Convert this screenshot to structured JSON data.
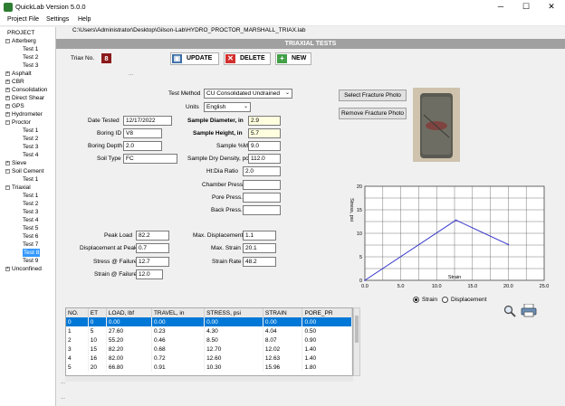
{
  "window": {
    "title": "QuickLab  Version 5.0.0",
    "minimize": "─",
    "maximize": "☐",
    "close": "✕"
  },
  "menu": {
    "items": [
      "Project File",
      "Settings",
      "Help"
    ]
  },
  "path": "C:\\Users\\Administrator\\Desktop\\Gilson-Lab\\HYDRO_PROCTOR_MARSHALL_TRIAX.lab",
  "tree": {
    "root": "PROJECT",
    "groups": [
      {
        "label": "Atterberg",
        "children": [
          "Test 1",
          "Test 2",
          "Test 3"
        ]
      },
      {
        "label": "Asphalt",
        "children": []
      },
      {
        "label": "CBR",
        "children": []
      },
      {
        "label": "Consolidation",
        "children": []
      },
      {
        "label": "Direct Shear",
        "children": []
      },
      {
        "label": "GPS",
        "children": []
      },
      {
        "label": "Hydrometer",
        "children": []
      },
      {
        "label": "Proctor",
        "children": [
          "Test 1",
          "Test 2",
          "Test 3",
          "Test 4"
        ]
      },
      {
        "label": "Sieve",
        "children": []
      },
      {
        "label": "Soil Cement",
        "children": [
          "Test 1"
        ]
      },
      {
        "label": "Triaxial",
        "children": [
          "Test 1",
          "Test 2",
          "Test 3",
          "Test 4",
          "Test 5",
          "Test 6",
          "Test 7",
          "Test 8",
          "Test 9"
        ]
      },
      {
        "label": "Unconfined",
        "children": []
      }
    ],
    "selected": "Triaxial/Test 8"
  },
  "header": {
    "title": "TRIAXIAL TESTS"
  },
  "triax": {
    "label": "Triax No.",
    "number": "8"
  },
  "actions": {
    "update": "UPDATE",
    "delete": "DELETE",
    "new": "NEW",
    "ellipsis": "..."
  },
  "form": {
    "test_method_label": "Test Method",
    "test_method": "CU Consolidated Undrained",
    "units_label": "Units",
    "units": "English",
    "date_tested_label": "Date Tested",
    "date_tested": "12/17/2022",
    "boring_id_label": "Boring ID",
    "boring_id": "V8",
    "boring_depth_label": "Boring Depth",
    "boring_depth": "2.0",
    "soil_type_label": "Soil Type",
    "soil_type": "FC",
    "sample_diameter_label": "Sample Diameter, in",
    "sample_diameter": "2.9",
    "sample_height_label": "Sample Height, in",
    "sample_height": "5.7",
    "sample_m_label": "Sample %M",
    "sample_m": "9.0",
    "sample_dry_density_label": "Sample Dry Density, pcf",
    "sample_dry_density": "112.0",
    "ht_dia_label": "Ht:Dia Ratio",
    "ht_dia": "2.0",
    "chamber_press_label": "Chamber Press.",
    "chamber_press": "",
    "pore_press_label": "Pore Press.",
    "pore_press": "",
    "back_press_label": "Back Press.",
    "back_press": "",
    "peak_load_label": "Peak Load",
    "peak_load": "82.2",
    "displacement_at_peak_label": "Displacement at Peak",
    "displacement_at_peak": "0.7",
    "stress_failure_label": "Stress @ Failure",
    "stress_failure": "12.7",
    "strain_failure_label": "Strain @ Failure",
    "strain_failure": "12.0",
    "max_displacement_label": "Max. Displacement",
    "max_displacement": "1.1",
    "max_strain_label": "Max. Strain",
    "max_strain": "20.1",
    "strain_rate_label": "Strain Rate",
    "strain_rate": "48.2"
  },
  "photo_buttons": {
    "select": "Select Fracture Photo",
    "remove": "Remove Fracture Photo"
  },
  "chart_data": {
    "type": "line",
    "xlabel": "Strain",
    "ylabel": "Stress, psi",
    "xlim": [
      0,
      25
    ],
    "ylim": [
      0,
      20
    ],
    "x_ticks": [
      "0.0",
      "5.0",
      "10.0",
      "15.0",
      "20.0",
      "25.0"
    ],
    "y_ticks": [
      "0",
      "5",
      "10",
      "15",
      "20"
    ],
    "grid": true,
    "series": [
      {
        "x": [
          0,
          12.7,
          20.0
        ],
        "y": [
          0,
          12.8,
          7.6
        ]
      }
    ],
    "line_color": "#3333cc"
  },
  "chart_toggle": {
    "strain": "Strain",
    "displacement": "Displacement",
    "selected": "strain"
  },
  "table": {
    "columns": [
      "NO.",
      "ET",
      "LOAD, lbf",
      "TRAVEL, in",
      "STRESS, psi",
      "STRAIN",
      "PORE_PR"
    ],
    "rows": [
      [
        "0",
        "0",
        "0.00",
        "0.00",
        "0.00",
        "0.00",
        "0.00"
      ],
      [
        "1",
        "5",
        "27.60",
        "0.23",
        "4.30",
        "4.04",
        "0.50"
      ],
      [
        "2",
        "10",
        "55.20",
        "0.46",
        "8.50",
        "8.07",
        "0.90"
      ],
      [
        "3",
        "15",
        "82.20",
        "0.68",
        "12.70",
        "12.02",
        "1.40"
      ],
      [
        "4",
        "16",
        "82.00",
        "0.72",
        "12.60",
        "12.63",
        "1.40"
      ],
      [
        "5",
        "20",
        "66.80",
        "0.91",
        "10.30",
        "15.96",
        "1.80"
      ]
    ],
    "selected_row": 0
  },
  "footer": {
    "ellipsis1": "...",
    "ellipsis2": "..."
  }
}
